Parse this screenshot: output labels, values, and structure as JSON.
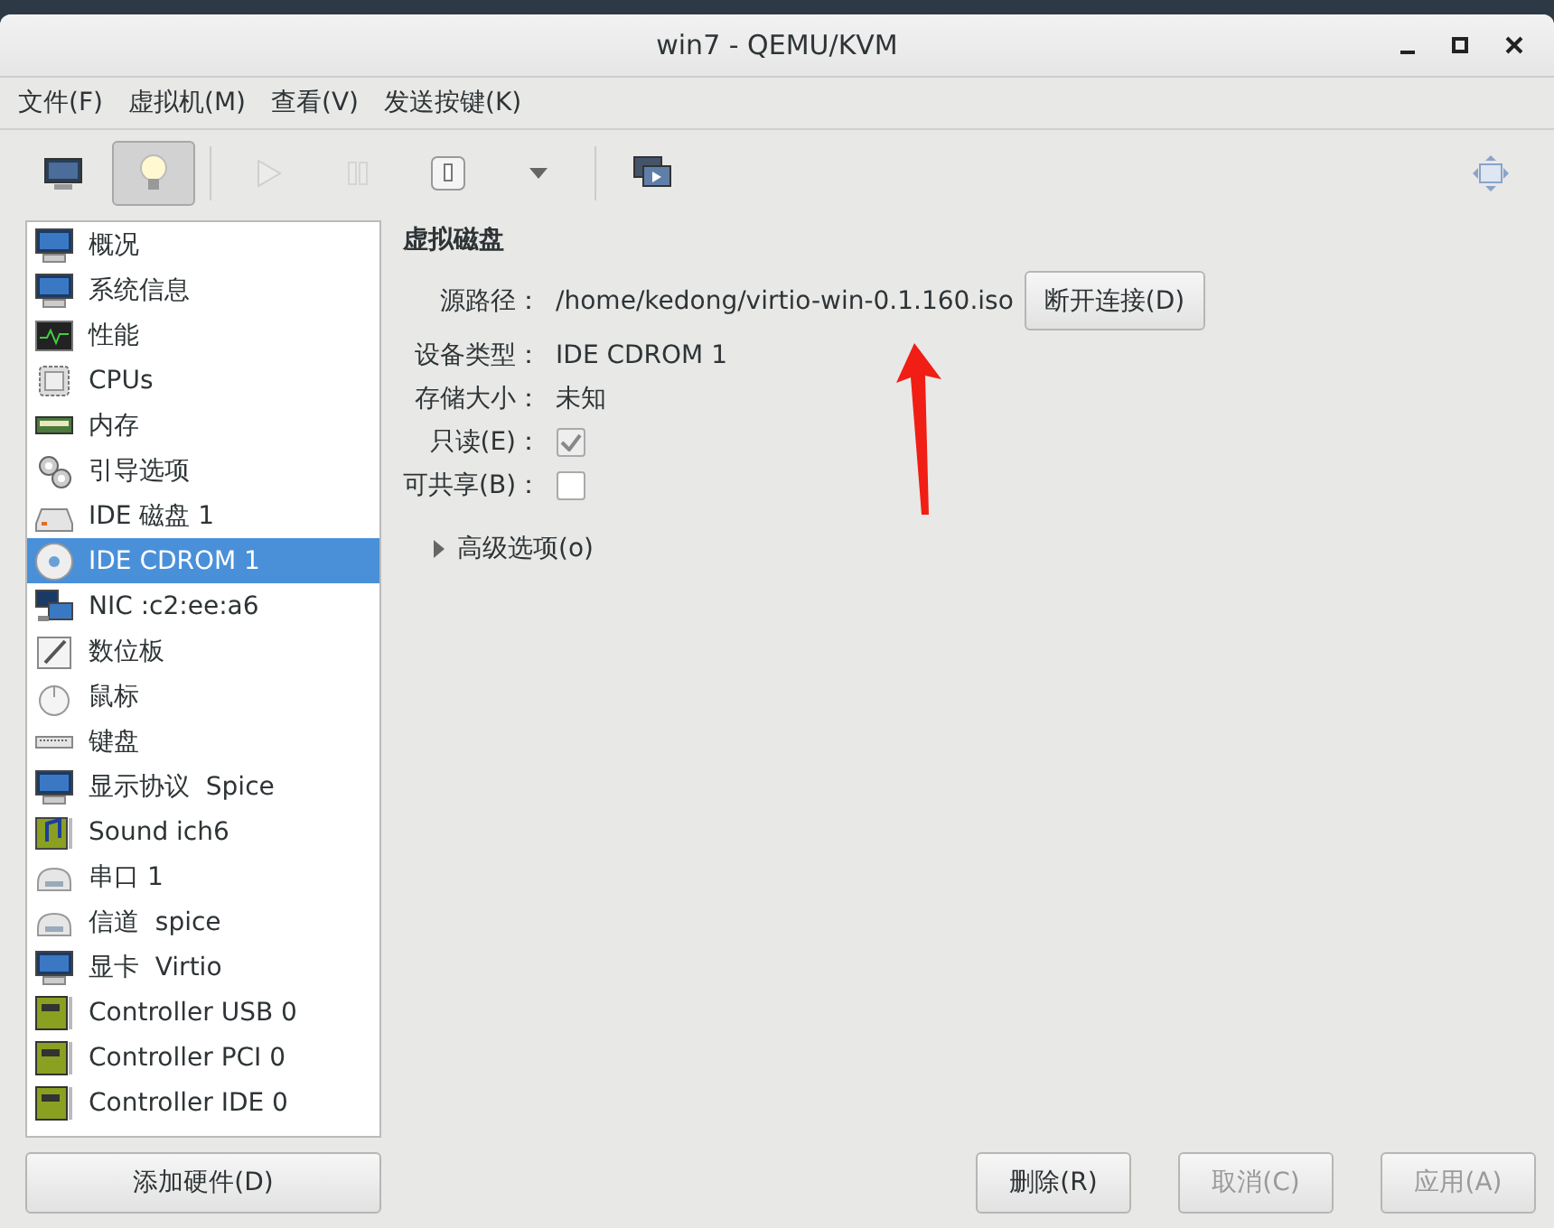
{
  "window": {
    "title": "win7 - QEMU/KVM"
  },
  "menu": [
    "文件(F)",
    "虚拟机(M)",
    "查看(V)",
    "发送按键(K)"
  ],
  "toolbar": [
    [
      {
        "kind": "console",
        "selected": false,
        "disabled": false
      },
      {
        "kind": "details",
        "selected": true,
        "disabled": false
      }
    ],
    [
      {
        "kind": "run",
        "selected": false,
        "disabled": true
      },
      {
        "kind": "pause",
        "selected": false,
        "disabled": true
      },
      {
        "kind": "stop",
        "selected": false,
        "disabled": false
      },
      {
        "kind": "dropdown",
        "selected": false,
        "disabled": false
      }
    ],
    [
      {
        "kind": "snapshots",
        "selected": false,
        "disabled": false
      },
      {
        "kind": "fullscreen",
        "selected": false,
        "disabled": false
      }
    ]
  ],
  "sidebar": {
    "items": [
      {
        "label": "概况",
        "kind": "monitor",
        "selected": false
      },
      {
        "label": "系统信息",
        "kind": "monitor",
        "selected": false
      },
      {
        "label": "性能",
        "kind": "perf",
        "selected": false
      },
      {
        "label": "CPUs",
        "kind": "cpu",
        "selected": false
      },
      {
        "label": "内存",
        "kind": "ram",
        "selected": false
      },
      {
        "label": "引导选项",
        "kind": "gears",
        "selected": false
      },
      {
        "label": "IDE 磁盘 1",
        "kind": "disk",
        "selected": false
      },
      {
        "label": "IDE CDROM 1",
        "kind": "cdrom",
        "selected": true
      },
      {
        "label": "NIC :c2:ee:a6",
        "kind": "nic",
        "selected": false
      },
      {
        "label": "数位板",
        "kind": "tablet",
        "selected": false
      },
      {
        "label": "鼠标",
        "kind": "mouse",
        "selected": false
      },
      {
        "label": "键盘",
        "kind": "keyboard",
        "selected": false
      },
      {
        "label": "显示协议  Spice",
        "kind": "monitor",
        "selected": false
      },
      {
        "label": "Sound ich6",
        "kind": "sound",
        "selected": false
      },
      {
        "label": "串口 1",
        "kind": "serial",
        "selected": false
      },
      {
        "label": "信道  spice",
        "kind": "serial",
        "selected": false
      },
      {
        "label": "显卡  Virtio",
        "kind": "monitor",
        "selected": false
      },
      {
        "label": "Controller USB 0",
        "kind": "card",
        "selected": false
      },
      {
        "label": "Controller PCI 0",
        "kind": "card",
        "selected": false
      },
      {
        "label": "Controller IDE 0",
        "kind": "card",
        "selected": false
      }
    ],
    "add_button": "添加硬件(D)"
  },
  "details": {
    "heading": "虚拟磁盘",
    "fields": [
      {
        "kind": "text",
        "label": "源路径：",
        "value": "/home/kedong/virtio-win-0.1.160.iso",
        "button": "断开连接(D)"
      },
      {
        "kind": "text",
        "label": "设备类型：",
        "value": "IDE CDROM 1"
      },
      {
        "kind": "text",
        "label": "存储大小：",
        "value": "未知"
      },
      {
        "kind": "check",
        "label": "只读(E)：",
        "checked": true,
        "disabled": true
      },
      {
        "kind": "check",
        "label": "可共享(B)：",
        "checked": false,
        "disabled": false
      }
    ],
    "advanced": {
      "label": "高级选项(o)",
      "expanded": false
    }
  },
  "buttons": [
    {
      "label": "删除(R)",
      "disabled": false
    },
    {
      "label": "取消(C)",
      "disabled": true
    },
    {
      "label": "应用(A)",
      "disabled": true
    }
  ]
}
